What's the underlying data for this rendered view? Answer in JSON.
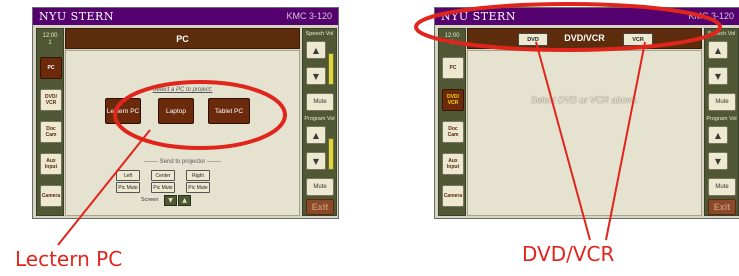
{
  "brand": "NYU STERN",
  "room": "KMC 3-120",
  "time": "12:00",
  "time_sub": "1",
  "sources": [
    "PC",
    "DVD/ VCR",
    "Doc Cam",
    "Aux Input",
    "Camera"
  ],
  "volume": {
    "speech_label": "Speech Vol",
    "program_label": "Program Vol",
    "mute": "Mute",
    "exit": "Exit",
    "up_icon": "▲",
    "down_icon": "▼"
  },
  "pc_screen": {
    "title": "PC",
    "prompt": "Select a PC to project:",
    "buttons": [
      "Lectern PC",
      "Laptop",
      "Tablet PC"
    ],
    "send_label": "------- Send to projector -------",
    "send_row": [
      "Left",
      "Center",
      "Right"
    ],
    "mute_row": [
      "Pic Mute",
      "Pic Mute",
      "Pic Mute"
    ],
    "screen_label": "Screen"
  },
  "dvd_screen": {
    "title": "DVD/VCR",
    "btn_left": "DVD",
    "btn_right": "VCR",
    "prompt": "Select DVD or VCR above."
  },
  "callouts": {
    "left": "Lectern PC",
    "right": "DVD/VCR"
  },
  "colors": {
    "brand_purple": "#54006e",
    "title_brown": "#5c2c0c",
    "button_brown": "#6b2a0c",
    "panel_olive": "#4f5734",
    "annotation_red": "#e0261c"
  }
}
